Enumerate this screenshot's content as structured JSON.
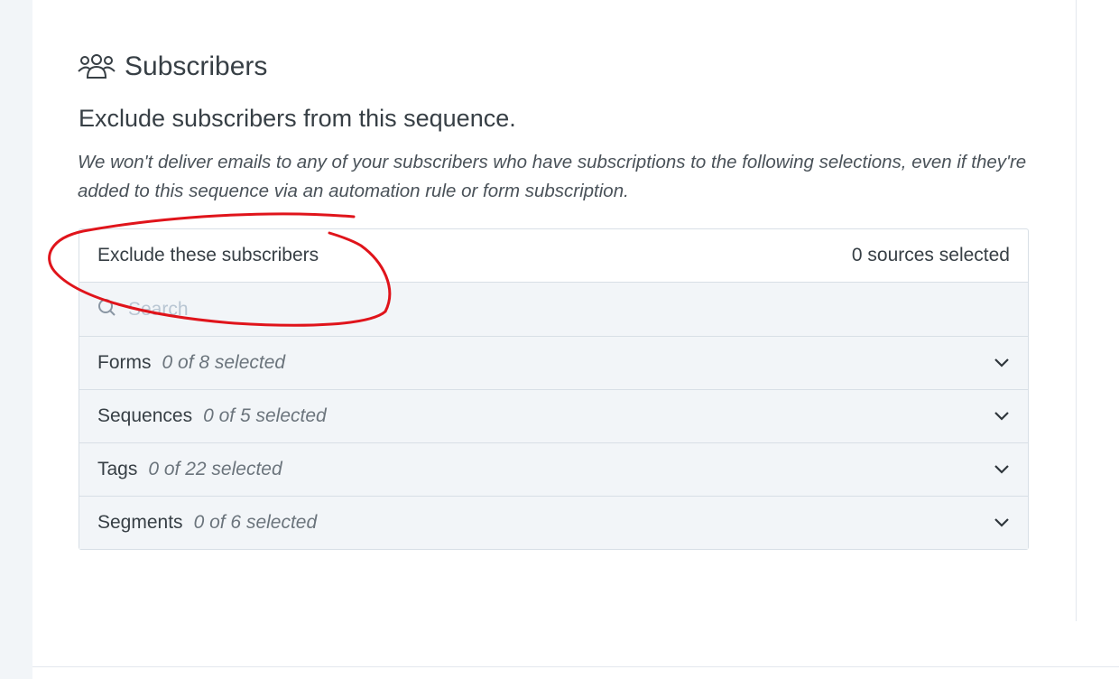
{
  "section": {
    "icon": "users-icon",
    "title": "Subscribers"
  },
  "subheading": "Exclude subscribers from this sequence.",
  "description": "We won't deliver emails to any of your subscribers who have subscriptions to the following selections, even if they're added to this sequence via an automation rule or form subscription.",
  "selector": {
    "label": "Exclude these subscribers",
    "sources_selected": "0 sources selected",
    "search": {
      "icon": "search-icon",
      "placeholder": "Search",
      "value": ""
    },
    "groups": [
      {
        "name": "Forms",
        "count": "0 of 8 selected",
        "icon": "chevron-down-icon"
      },
      {
        "name": "Sequences",
        "count": "0 of 5 selected",
        "icon": "chevron-down-icon"
      },
      {
        "name": "Tags",
        "count": "0 of 22 selected",
        "icon": "chevron-down-icon"
      },
      {
        "name": "Segments",
        "count": "0 of 6 selected",
        "icon": "chevron-down-icon"
      }
    ]
  },
  "annotation": {
    "type": "hand-drawn circle",
    "color": "#e0141b"
  },
  "colors": {
    "text": "#373f45",
    "muted_text": "#6b747c",
    "placeholder": "#b9c6d3",
    "row_background": "#f2f5f8",
    "border": "#d8dfe6"
  }
}
